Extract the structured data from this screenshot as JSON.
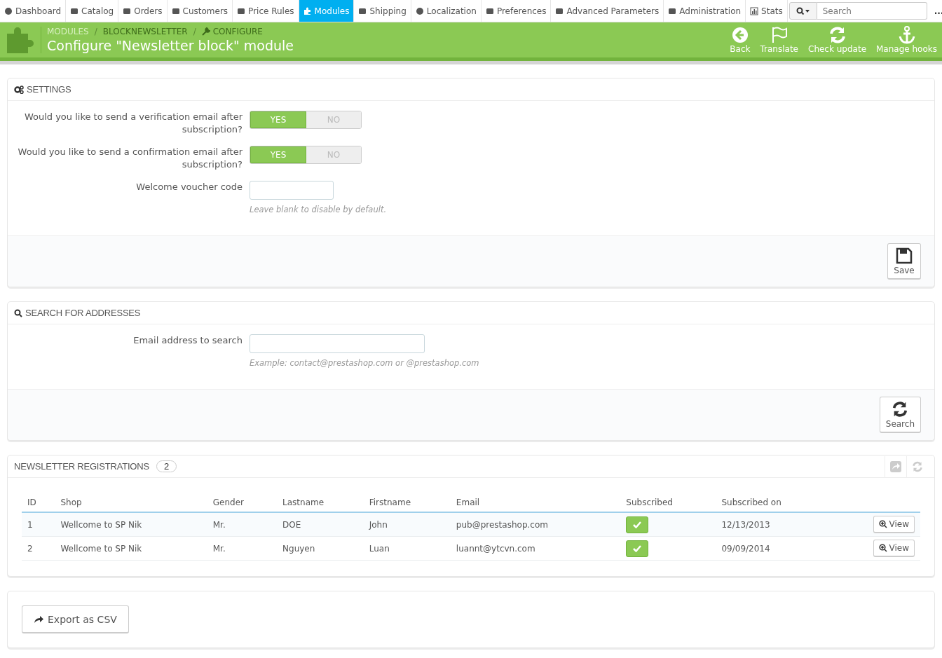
{
  "nav": {
    "items": [
      {
        "label": "Dashboard",
        "selected": false
      },
      {
        "label": "Catalog",
        "selected": false
      },
      {
        "label": "Orders",
        "selected": false
      },
      {
        "label": "Customers",
        "selected": false
      },
      {
        "label": "Price Rules",
        "selected": false
      },
      {
        "label": "Modules",
        "selected": true
      },
      {
        "label": "Shipping",
        "selected": false
      },
      {
        "label": "Localization",
        "selected": false
      },
      {
        "label": "Preferences",
        "selected": false
      },
      {
        "label": "Advanced Parameters",
        "selected": false
      },
      {
        "label": "Administration",
        "selected": false
      },
      {
        "label": "Stats",
        "selected": false
      }
    ],
    "search": {
      "placeholder": "Search"
    },
    "more": "..."
  },
  "header": {
    "breadcrumb": [
      {
        "kind": "link",
        "label": "MODULES"
      },
      {
        "kind": "separator",
        "label": "/"
      },
      {
        "kind": "link",
        "label": "BLOCKNEWSLETTER"
      },
      {
        "kind": "separator",
        "label": "/"
      },
      {
        "kind": "current",
        "label": "CONFIGURE"
      }
    ],
    "title": "Configure \"Newsletter block\" module",
    "toolbar": [
      {
        "label": "Back"
      },
      {
        "label": "Translate"
      },
      {
        "label": "Check update"
      },
      {
        "label": "Manage hooks"
      }
    ]
  },
  "settings": {
    "title": "SETTINGS",
    "fields": [
      {
        "kind": "switch",
        "label": "Would you like to send a verification email after subscription?",
        "options": [
          {
            "label": "YES",
            "selected": true
          },
          {
            "label": "NO",
            "selected": false
          }
        ]
      },
      {
        "kind": "switch",
        "label": "Would you like to send a confirmation email after subscription?",
        "options": [
          {
            "label": "YES",
            "selected": true
          },
          {
            "label": "NO",
            "selected": false
          }
        ]
      },
      {
        "kind": "text",
        "label": "Welcome voucher code",
        "help": "Leave blank to disable by default."
      }
    ],
    "button": "Save"
  },
  "search_panel": {
    "title": "SEARCH FOR ADDRESSES",
    "fields": [
      {
        "kind": "text",
        "label": "Email address to search",
        "help": "Example: contact@prestashop.com or @prestashop.com"
      }
    ],
    "button": "Search"
  },
  "registrations": {
    "title": "NEWSLETTER REGISTRATIONS",
    "count": "2",
    "columns": [
      "ID",
      "Shop",
      "Gender",
      "Lastname",
      "Firstname",
      "Email",
      "Subscribed",
      "Subscribed on"
    ],
    "rows": [
      {
        "cells": [
          "1",
          "Wellcome to SP Nik",
          "Mr.",
          "DOE",
          "John",
          "pub@prestashop.com"
        ],
        "subscribed": true,
        "date": "12/13/2013",
        "action": "View"
      },
      {
        "cells": [
          "2",
          "Wellcome to SP Nik",
          "Mr.",
          "Nguyen",
          "Luan",
          "luannt@ytcvn.com"
        ],
        "subscribed": true,
        "date": "09/09/2014",
        "action": "View"
      }
    ]
  },
  "export": {
    "button": "Export as CSV"
  }
}
